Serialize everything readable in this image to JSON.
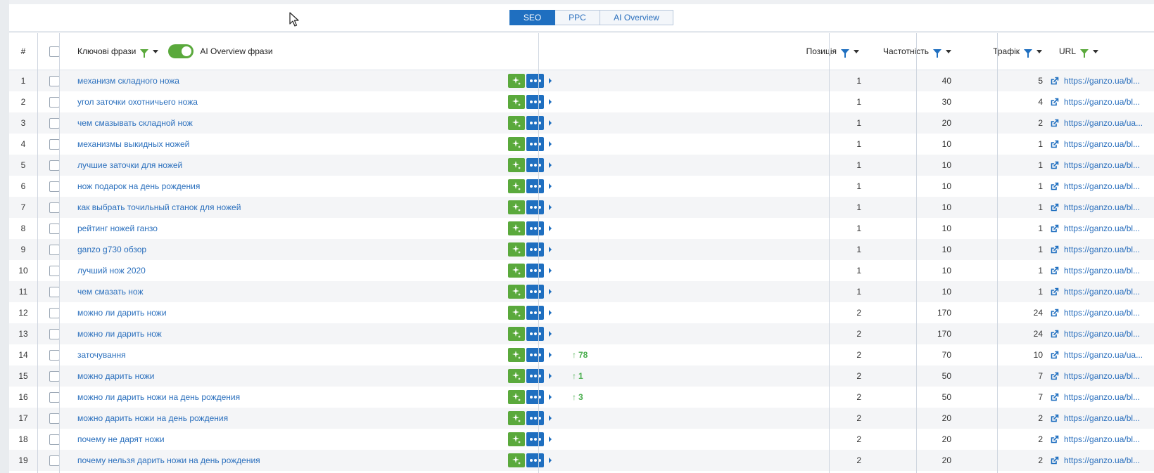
{
  "tabs": [
    {
      "label": "SEO",
      "active": true
    },
    {
      "label": "PPC",
      "active": false
    },
    {
      "label": "AI Overview",
      "active": false
    }
  ],
  "columns": {
    "num": "#",
    "keywords": "Ключові фрази",
    "ai_toggle_label": "AI Overview фрази",
    "position": "Позиція",
    "frequency": "Частотність",
    "traffic": "Трафік",
    "url": "URL"
  },
  "rows": [
    {
      "n": "1",
      "kw": "механизм складного ножа",
      "diff": "",
      "pos": "1",
      "freq": "40",
      "traf": "5",
      "url": "https://ganzo.ua/bl..."
    },
    {
      "n": "2",
      "kw": "угол заточки охотничьего ножа",
      "diff": "",
      "pos": "1",
      "freq": "30",
      "traf": "4",
      "url": "https://ganzo.ua/bl..."
    },
    {
      "n": "3",
      "kw": "чем смазывать складной нож",
      "diff": "",
      "pos": "1",
      "freq": "20",
      "traf": "2",
      "url": "https://ganzo.ua/ua..."
    },
    {
      "n": "4",
      "kw": "механизмы выкидных ножей",
      "diff": "",
      "pos": "1",
      "freq": "10",
      "traf": "1",
      "url": "https://ganzo.ua/bl..."
    },
    {
      "n": "5",
      "kw": "лучшие заточки для ножей",
      "diff": "",
      "pos": "1",
      "freq": "10",
      "traf": "1",
      "url": "https://ganzo.ua/bl..."
    },
    {
      "n": "6",
      "kw": "нож подарок на день рождения",
      "diff": "",
      "pos": "1",
      "freq": "10",
      "traf": "1",
      "url": "https://ganzo.ua/bl..."
    },
    {
      "n": "7",
      "kw": "как выбрать точильный станок для ножей",
      "diff": "",
      "pos": "1",
      "freq": "10",
      "traf": "1",
      "url": "https://ganzo.ua/bl..."
    },
    {
      "n": "8",
      "kw": "рейтинг ножей ганзо",
      "diff": "",
      "pos": "1",
      "freq": "10",
      "traf": "1",
      "url": "https://ganzo.ua/bl..."
    },
    {
      "n": "9",
      "kw": "ganzo g730 обзор",
      "diff": "",
      "pos": "1",
      "freq": "10",
      "traf": "1",
      "url": "https://ganzo.ua/bl..."
    },
    {
      "n": "10",
      "kw": "лучший нож 2020",
      "diff": "",
      "pos": "1",
      "freq": "10",
      "traf": "1",
      "url": "https://ganzo.ua/bl..."
    },
    {
      "n": "11",
      "kw": "чем смазать нож",
      "diff": "",
      "pos": "1",
      "freq": "10",
      "traf": "1",
      "url": "https://ganzo.ua/bl..."
    },
    {
      "n": "12",
      "kw": "можно ли дарить ножи",
      "diff": "",
      "pos": "2",
      "freq": "170",
      "traf": "24",
      "url": "https://ganzo.ua/bl..."
    },
    {
      "n": "13",
      "kw": "можно ли дарить нож",
      "diff": "",
      "pos": "2",
      "freq": "170",
      "traf": "24",
      "url": "https://ganzo.ua/bl..."
    },
    {
      "n": "14",
      "kw": "заточування",
      "diff": "78",
      "pos": "2",
      "freq": "70",
      "traf": "10",
      "url": "https://ganzo.ua/ua..."
    },
    {
      "n": "15",
      "kw": "можно дарить ножи",
      "diff": "1",
      "pos": "2",
      "freq": "50",
      "traf": "7",
      "url": "https://ganzo.ua/bl..."
    },
    {
      "n": "16",
      "kw": "можно ли дарить ножи на день рождения",
      "diff": "3",
      "pos": "2",
      "freq": "50",
      "traf": "7",
      "url": "https://ganzo.ua/bl..."
    },
    {
      "n": "17",
      "kw": "можно дарить ножи на день рождения",
      "diff": "",
      "pos": "2",
      "freq": "20",
      "traf": "2",
      "url": "https://ganzo.ua/bl..."
    },
    {
      "n": "18",
      "kw": "почему не дарят ножи",
      "diff": "",
      "pos": "2",
      "freq": "20",
      "traf": "2",
      "url": "https://ganzo.ua/bl..."
    },
    {
      "n": "19",
      "kw": "почему нельзя дарить ножи на день рождения",
      "diff": "",
      "pos": "2",
      "freq": "20",
      "traf": "2",
      "url": "https://ganzo.ua/bl..."
    }
  ],
  "icons": {
    "ai_button": "sparkle-icon",
    "more_button": "more-dots-icon",
    "expand": "caret-right-icon",
    "url_link": "external-link-icon",
    "filter": "filter-icon",
    "diff_up": "arrow-up-icon"
  },
  "colors": {
    "accent": "#1f6fc0",
    "green": "#5aa93c"
  }
}
